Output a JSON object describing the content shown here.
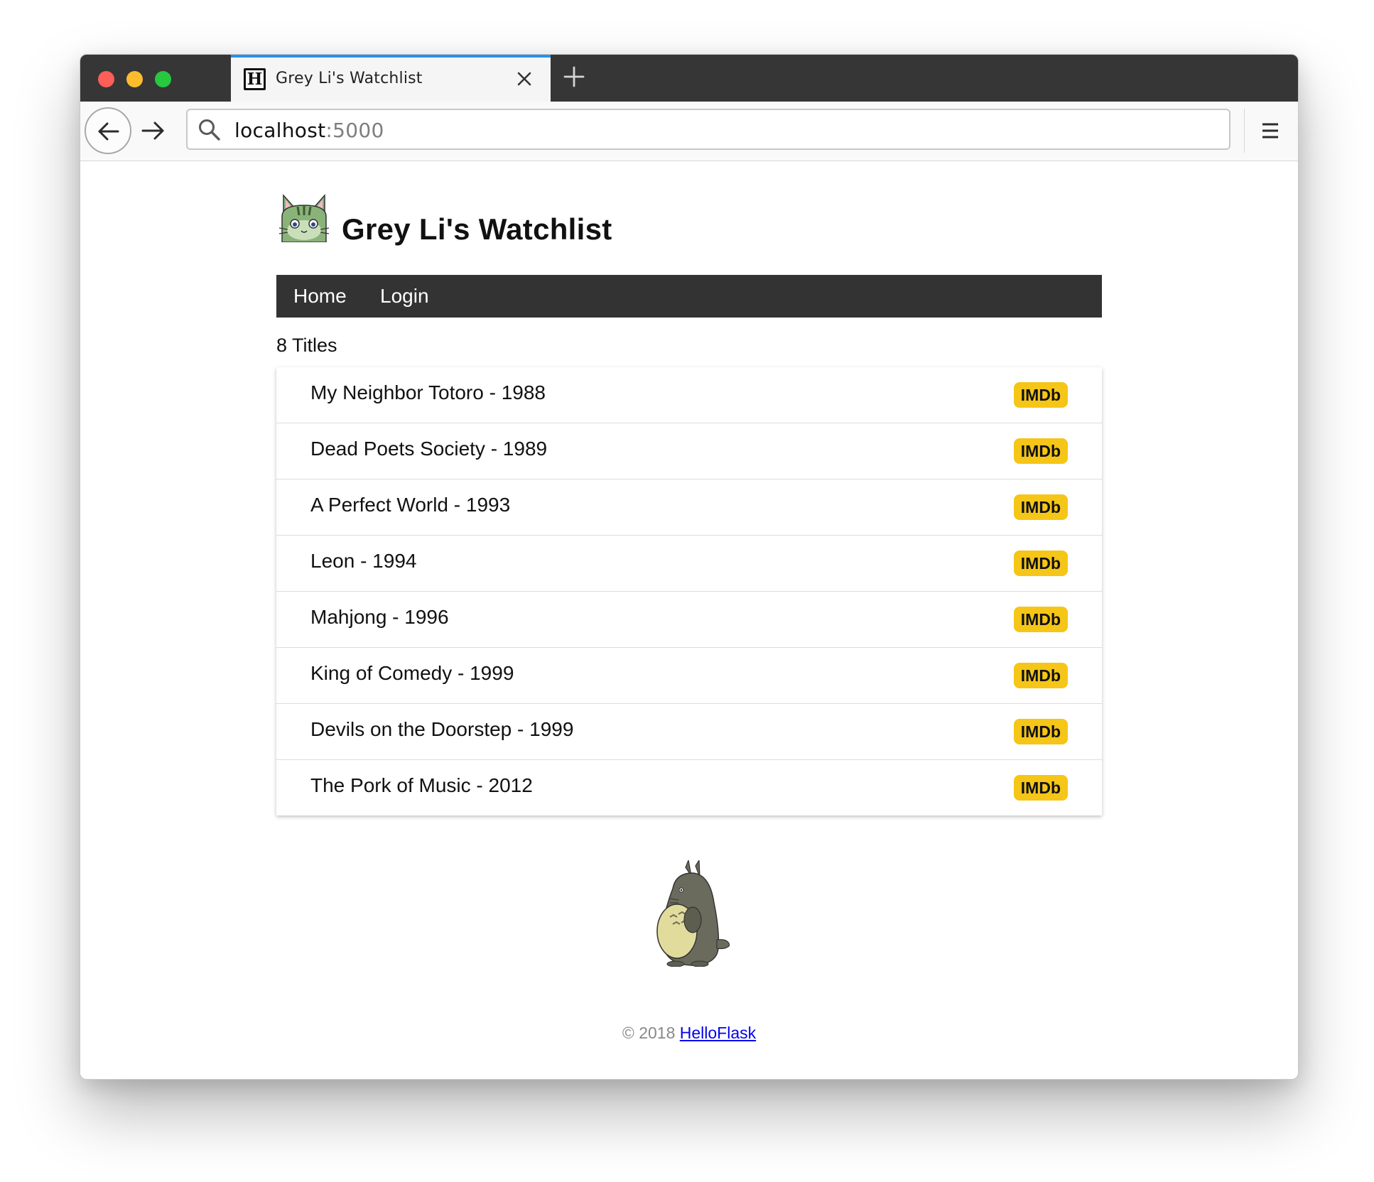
{
  "browser": {
    "tab_title": "Grey Li's Watchlist",
    "tab_favicon": "H",
    "url_host": "localhost",
    "url_port": ":5000",
    "icons": [
      "back-arrow-icon",
      "forward-arrow-icon",
      "search-icon",
      "close-icon",
      "plus-icon",
      "hamburger-menu-icon"
    ]
  },
  "page": {
    "title": "Grey Li's Watchlist",
    "nav": {
      "home": "Home",
      "login": "Login"
    },
    "count_text": "8 Titles",
    "movies": [
      {
        "title": "My Neighbor Totoro - 1988",
        "badge": "IMDb"
      },
      {
        "title": "Dead Poets Society - 1989",
        "badge": "IMDb"
      },
      {
        "title": "A Perfect World - 1993",
        "badge": "IMDb"
      },
      {
        "title": "Leon - 1994",
        "badge": "IMDb"
      },
      {
        "title": "Mahjong - 1996",
        "badge": "IMDb"
      },
      {
        "title": "King of Comedy - 1999",
        "badge": "IMDb"
      },
      {
        "title": "Devils on the Doorstep - 1999",
        "badge": "IMDb"
      },
      {
        "title": "The Pork of Music - 2012",
        "badge": "IMDb"
      }
    ],
    "footer": {
      "copyright": "© 2018",
      "link": "HelloFlask"
    }
  },
  "colors": {
    "tabbar": "#363636",
    "tab_accent": "#2a90ea",
    "navbar": "#333333",
    "imdb_badge": "#f5c518",
    "link": "#0000ee"
  }
}
